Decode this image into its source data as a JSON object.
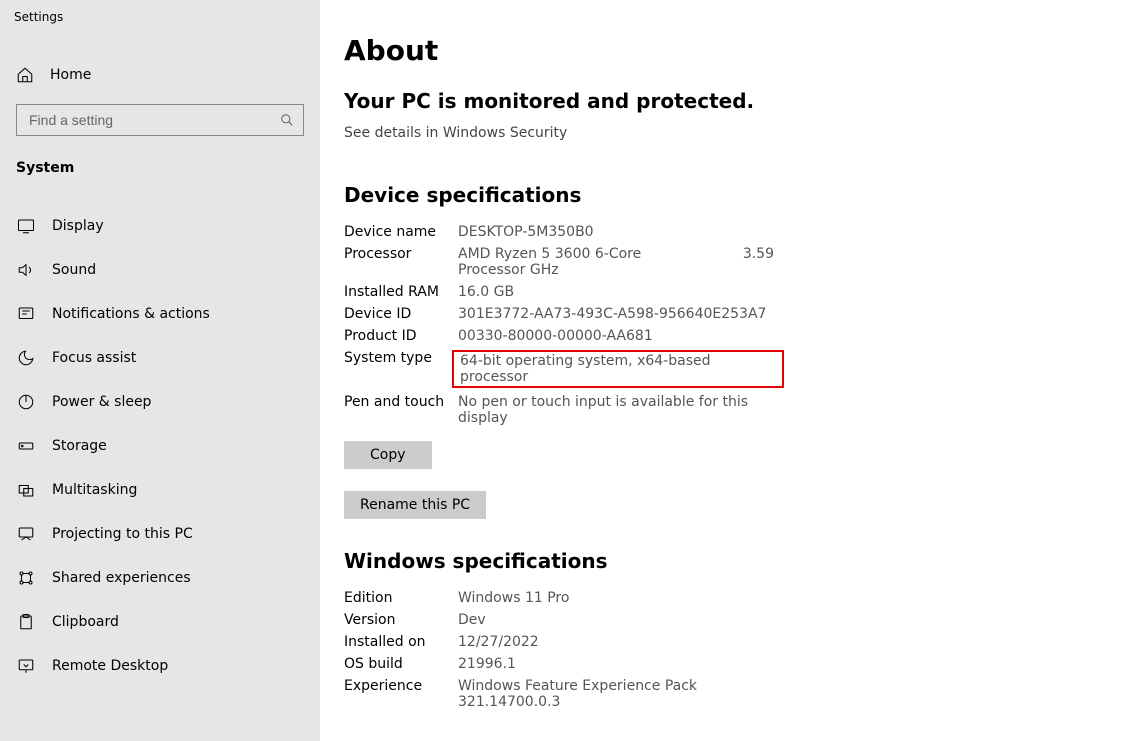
{
  "sidebar": {
    "title": "Settings",
    "home": "Home",
    "search_placeholder": "Find a setting",
    "section": "System",
    "items": [
      {
        "icon": "display-icon",
        "label": "Display"
      },
      {
        "icon": "sound-icon",
        "label": "Sound"
      },
      {
        "icon": "notifications-icon",
        "label": "Notifications & actions"
      },
      {
        "icon": "focus-icon",
        "label": "Focus assist"
      },
      {
        "icon": "power-icon",
        "label": "Power & sleep"
      },
      {
        "icon": "storage-icon",
        "label": "Storage"
      },
      {
        "icon": "multitasking-icon",
        "label": "Multitasking"
      },
      {
        "icon": "projecting-icon",
        "label": "Projecting to this PC"
      },
      {
        "icon": "shared-icon",
        "label": "Shared experiences"
      },
      {
        "icon": "clipboard-icon",
        "label": "Clipboard"
      },
      {
        "icon": "remote-icon",
        "label": "Remote Desktop"
      }
    ]
  },
  "main": {
    "title": "About",
    "monitor_heading": "Your PC is monitored and protected.",
    "security_link": "See details in Windows Security",
    "device_section": "Device specifications",
    "device_specs": {
      "device_name": {
        "label": "Device name",
        "value": "DESKTOP-5M350B0"
      },
      "processor": {
        "label": "Processor",
        "value": "AMD Ryzen 5 3600 6-Core Processor GHz",
        "extra": "3.59"
      },
      "ram": {
        "label": "Installed RAM",
        "value": "16.0 GB"
      },
      "device_id": {
        "label": "Device ID",
        "value": "301E3772-AA73-493C-A598-956640E253A7"
      },
      "product_id": {
        "label": "Product ID",
        "value": "00330-80000-00000-AA681"
      },
      "system_type": {
        "label": "System type",
        "value": "64-bit operating system, x64-based processor"
      },
      "pen_touch": {
        "label": "Pen and touch",
        "value": "No pen or touch input is available for this display"
      }
    },
    "copy_btn": "Copy",
    "rename_btn": "Rename this PC",
    "windows_section": "Windows specifications",
    "win_specs": {
      "edition": {
        "label": "Edition",
        "value": "Windows 11 Pro"
      },
      "version": {
        "label": "Version",
        "value": "Dev"
      },
      "installed_on": {
        "label": "Installed on",
        "value": "12/27/2022"
      },
      "os_build": {
        "label": "OS build",
        "value": "21996.1"
      },
      "experience": {
        "label": "Experience",
        "value": "Windows Feature Experience Pack 321.14700.0.3"
      }
    }
  }
}
